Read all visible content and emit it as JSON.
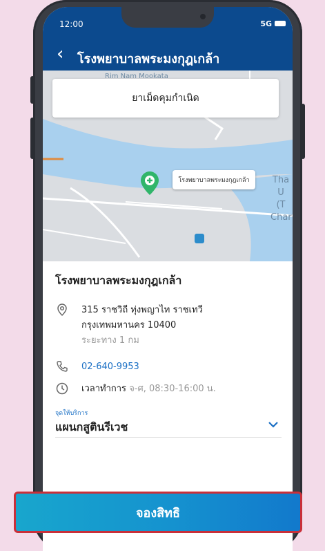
{
  "status_bar": {
    "time": "12:00",
    "signal": "5G"
  },
  "header": {
    "back_icon": "chevron-left-icon",
    "title": "โรงพยาบาลพระมงกุฎเกล้า"
  },
  "map": {
    "area_label_top": "Rim Nam Mookata",
    "area_label_right": "Tha\nU\n(T\nChar",
    "service_title": "ยาเม็ดคุมกำเนิด",
    "pin_label": "โรงพยาบาลพระมงกุฎเกล้า",
    "pin_icon": "location-pin-icon",
    "transit_icon": "transit-icon"
  },
  "hospital": {
    "name": "โรงพยาบาลพระมงกุฎเกล้า",
    "address_line1": "315 ราชวิถี ทุ่งพญาไท ราชเทวี",
    "address_line2": "กรุงเทพมหานคร 10400",
    "distance": "ระยะทาง 1 กม",
    "phone": "02-640-9953",
    "hours_label": "เวลาทำการ",
    "hours_value": "จ-ศ, 08:30-16:00 น."
  },
  "service_point": {
    "label": "จุดให้บริการ",
    "value": "แผนกสูตินรีเวช"
  },
  "actions": {
    "book_label": "จองสิทธิ"
  },
  "colors": {
    "brand": "#0c4a8e",
    "link": "#1a6fc4",
    "button_start": "#18a6cd",
    "button_end": "#1279cc",
    "highlight_border": "#c9303a"
  }
}
